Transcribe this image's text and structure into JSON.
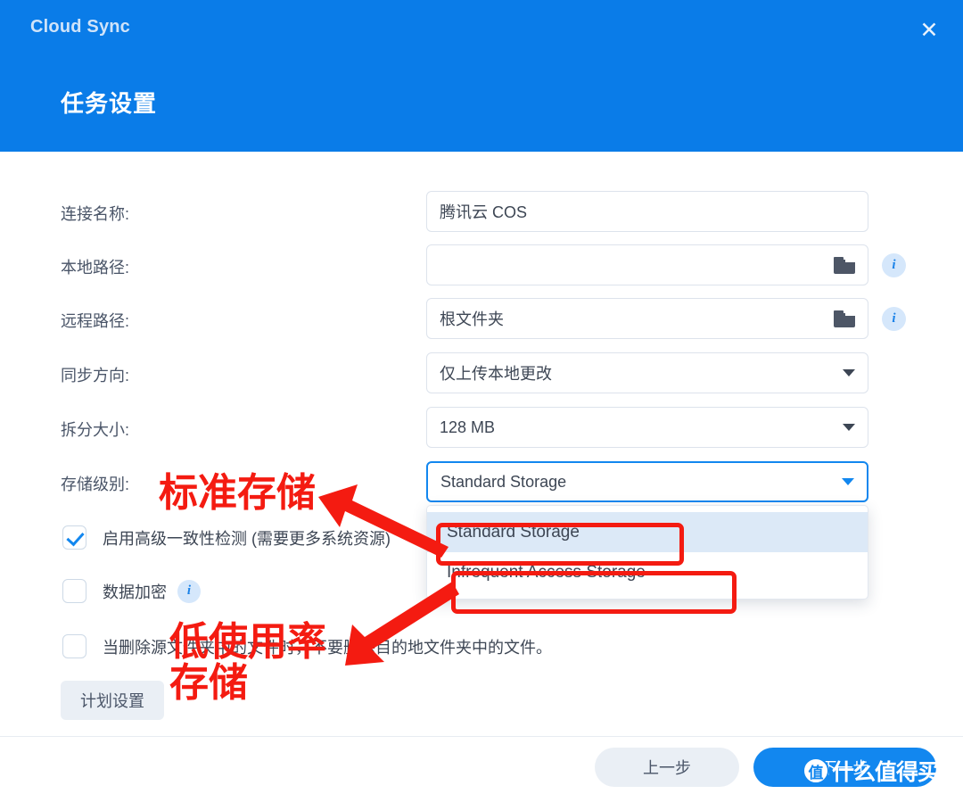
{
  "window": {
    "app_title": "Cloud Sync",
    "dialog_title": "任务设置",
    "close_label": "✕",
    "header_color": "#0a7ce8"
  },
  "form": {
    "fields": [
      {
        "label": "连接名称:",
        "value": "腾讯云 COS",
        "type": "text",
        "has_folder": false,
        "has_info": false
      },
      {
        "label": "本地路径:",
        "value": "",
        "type": "text",
        "has_folder": true,
        "has_info": true
      },
      {
        "label": "远程路径:",
        "value": "根文件夹",
        "type": "text",
        "has_folder": true,
        "has_info": true
      },
      {
        "label": "同步方向:",
        "value": "仅上传本地更改",
        "type": "select",
        "has_folder": false,
        "has_info": false
      },
      {
        "label": "拆分大小:",
        "value": "128 MB",
        "type": "select",
        "has_folder": false,
        "has_info": false
      },
      {
        "label": "存储级别:",
        "value": "Standard Storage",
        "type": "select",
        "has_folder": false,
        "has_info": false
      }
    ]
  },
  "storage_dropdown": {
    "open": true,
    "options": [
      {
        "label": "Standard Storage",
        "selected": true
      },
      {
        "label": "Infrequent Access Storage",
        "selected": false
      }
    ]
  },
  "checkboxes": [
    {
      "label": "启用高级一致性检测 (需要更多系统资源)",
      "checked": true,
      "has_info": false
    },
    {
      "label": "数据加密",
      "checked": false,
      "has_info": true
    },
    {
      "label": "当删除源文件夹中的文件时，不要删除目的地文件夹中的文件。",
      "checked": false,
      "has_info": false
    }
  ],
  "schedule_button": {
    "label": "计划设置"
  },
  "footer": {
    "prev_label": "上一步",
    "next_label": "下一步"
  },
  "watermark": {
    "badge": "值",
    "text": "什么值得买"
  },
  "annotations": {
    "color": "#f41b11",
    "standard_note": "标准存储",
    "infrequent_note": "低使用率\n存储"
  },
  "icons": {
    "info": "i",
    "folder": "folder-icon"
  }
}
